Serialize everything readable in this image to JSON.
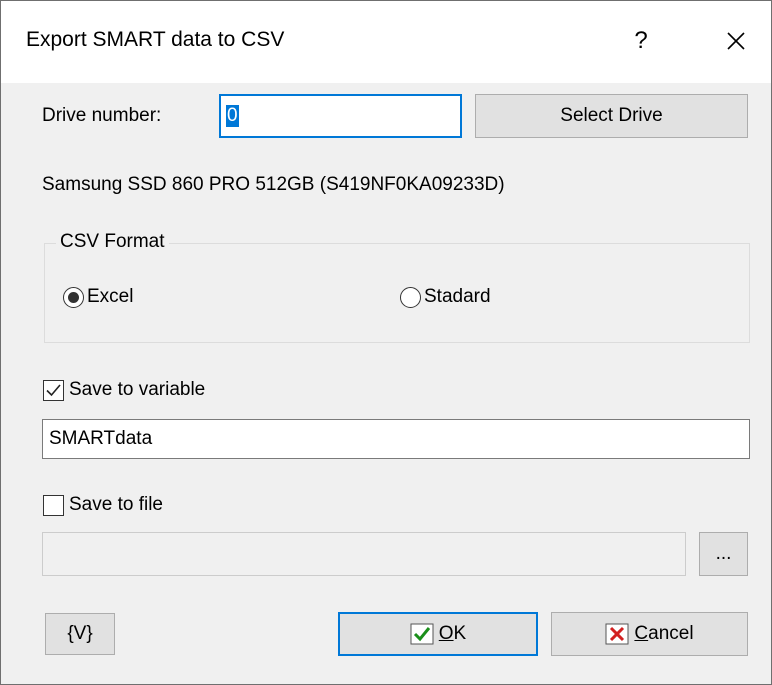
{
  "window": {
    "title": "Export SMART data to CSV",
    "help_label": "?",
    "close_icon": "close-icon"
  },
  "drive": {
    "label": "Drive number:",
    "value": "0",
    "select_button": "Select Drive",
    "description": "Samsung SSD 860 PRO 512GB (S419NF0KA09233D)"
  },
  "csv_format": {
    "legend": "CSV Format",
    "options": [
      {
        "label": "Excel",
        "selected": true
      },
      {
        "label": "Stadard",
        "selected": false
      }
    ]
  },
  "variable": {
    "checkbox_label": "Save to variable",
    "checked": true,
    "value": "SMARTdata"
  },
  "file": {
    "checkbox_label": "Save to file",
    "checked": false,
    "value": "",
    "browse_label": "..."
  },
  "footer": {
    "variables_button": "{V}",
    "ok_first": "O",
    "ok_rest": "K",
    "cancel_first": "C",
    "cancel_rest": "ancel",
    "ok_icon": "checkmark-icon",
    "cancel_icon": "x-icon"
  },
  "colors": {
    "accent": "#0078d7",
    "ok_check": "#1a8f1a",
    "cancel_x": "#d22020"
  }
}
